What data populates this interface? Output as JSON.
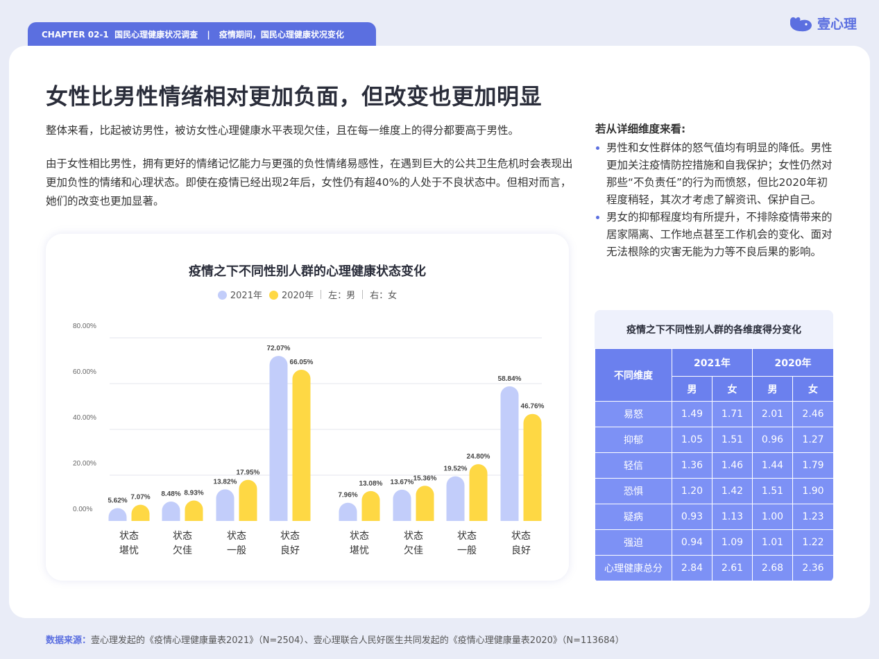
{
  "header": {
    "chapter": "CHAPTER 02-1",
    "section": "国民心理健康状况调查",
    "separator": "|",
    "subsection": "疫情期间，国民心理健康状况变化",
    "brand": "壹心理"
  },
  "title": "女性比男性情绪相对更加负面，但改变也更加明显",
  "intro": [
    "整体来看，比起被访男性，被访女性心理健康水平表现欠佳，且在每一维度上的得分都要高于男性。",
    "由于女性相比男性，拥有更好的情绪记忆能力与更强的负性情绪易感性，在遇到巨大的公共卫生危机时会表现出更加负性的情绪和心理状态。即使在疫情已经出现2年后，女性仍有超40%的人处于不良状态中。但相对而言，她们的改变也更加显著。"
  ],
  "detail": {
    "heading": "若从详细维度来看:",
    "bullets": [
      "男性和女性群体的怒气值均有明显的降低。男性更加关注疫情防控措施和自我保护；女性仍然对那些“不负责任”的行为而愤怒，但比2020年初程度稍轻，其次才考虑了解资讯、保护自己。",
      "男女的抑郁程度均有所提升，不排除疫情带来的居家隔离、工作地点甚至工作机会的变化、面对无法根除的灾害无能为力等不良后果的影响。"
    ]
  },
  "chart_data": {
    "type": "bar",
    "title": "疫情之下不同性别人群的心理健康状态变化",
    "legend": [
      "2021年",
      "2020年",
      "左：男",
      "右：女"
    ],
    "legend_placement": "top-center",
    "colors": {
      "2021年": "#c2cdfa",
      "2020年": "#fed844"
    },
    "groups": [
      "男",
      "女"
    ],
    "categories": [
      [
        "状态",
        "堪忧"
      ],
      [
        "状态",
        "欠佳"
      ],
      [
        "状态",
        "一般"
      ],
      [
        "状态",
        "良好"
      ],
      [
        "状态",
        "堪忧"
      ],
      [
        "状态",
        "欠佳"
      ],
      [
        "状态",
        "一般"
      ],
      [
        "状态",
        "良好"
      ]
    ],
    "series": [
      {
        "name": "2021年",
        "values": [
          5.62,
          8.48,
          13.82,
          72.07,
          7.96,
          13.67,
          19.52,
          58.84
        ],
        "labels": [
          "5.62%",
          "8.48%",
          "13.82%",
          "72.07%",
          "7.96%",
          "13.67%",
          "19.52%",
          "58.84%"
        ]
      },
      {
        "name": "2020年",
        "values": [
          7.07,
          8.93,
          17.95,
          66.05,
          13.08,
          15.36,
          24.8,
          46.76
        ],
        "labels": [
          "7.07%",
          "8.93%",
          "17.95%",
          "66.05%",
          "13.08%",
          "15.36%",
          "24.80%",
          "46.76%"
        ]
      }
    ],
    "yticks": [
      "0.00%",
      "20.00%",
      "40.00%",
      "60.00%",
      "80.00%"
    ],
    "ylim": [
      0,
      80
    ],
    "grid": true
  },
  "table": {
    "title": "疫情之下不同性别人群的各维度得分变化",
    "dim_header": "不同维度",
    "years": [
      "2021年",
      "2020年"
    ],
    "sexes": [
      "男",
      "女",
      "男",
      "女"
    ],
    "rows": [
      {
        "name": "易怒",
        "values": [
          "1.49",
          "1.71",
          "2.01",
          "2.46"
        ]
      },
      {
        "name": "抑郁",
        "values": [
          "1.05",
          "1.51",
          "0.96",
          "1.27"
        ]
      },
      {
        "name": "轻信",
        "values": [
          "1.36",
          "1.46",
          "1.44",
          "1.79"
        ]
      },
      {
        "name": "恐惧",
        "values": [
          "1.20",
          "1.42",
          "1.51",
          "1.90"
        ]
      },
      {
        "name": "疑病",
        "values": [
          "0.93",
          "1.13",
          "1.00",
          "1.23"
        ]
      },
      {
        "name": "强迫",
        "values": [
          "0.94",
          "1.09",
          "1.01",
          "1.22"
        ]
      },
      {
        "name": "心理健康总分",
        "values": [
          "2.84",
          "2.61",
          "2.68",
          "2.36"
        ]
      }
    ]
  },
  "footer": {
    "label": "数据来源：",
    "text": "壹心理发起的《疫情心理健康量表2021》（N=2504）、壹心理联合人民好医生共同发起的《疫情心理健康量表2020》（N=113684）"
  }
}
